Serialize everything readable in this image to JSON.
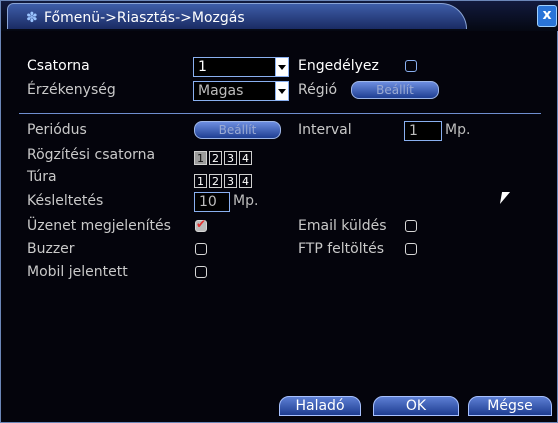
{
  "window": {
    "title": "Főmenü->Riasztás->Mozgás",
    "close_glyph": "x"
  },
  "form": {
    "csatorna": {
      "label": "Csatorna",
      "value": "1"
    },
    "engedelyez": {
      "label": "Engedélyez",
      "checked": false
    },
    "erzekenyseg": {
      "label": "Érzékenység",
      "value": "Magas"
    },
    "regio": {
      "label": "Régió",
      "button": "Beállít"
    },
    "periodus": {
      "label": "Periódus",
      "button": "Beállít"
    },
    "interval": {
      "label": "Interval",
      "value": "1",
      "unit": "Mp."
    },
    "rogzitesi": {
      "label": "Rögzítési csatorna",
      "channels": [
        "1",
        "2",
        "3",
        "4"
      ],
      "selected": [
        "1"
      ]
    },
    "tura": {
      "label": "Túra",
      "channels": [
        "1",
        "2",
        "3",
        "4"
      ],
      "selected": []
    },
    "kesleltetes": {
      "label": "Késleltetés",
      "value": "10",
      "unit": "Mp."
    },
    "uzenet": {
      "label": "Üzenet megjelenítés",
      "checked": true
    },
    "email": {
      "label": "Email küldés",
      "checked": false
    },
    "buzzer": {
      "label": "Buzzer",
      "checked": false
    },
    "ftp": {
      "label": "FTP feltöltés",
      "checked": false
    },
    "mobil": {
      "label": "Mobil jelentett",
      "checked": false
    }
  },
  "buttons": {
    "halado": "Haladó",
    "ok": "OK",
    "megse": "Mégse"
  },
  "colors": {
    "accent": "#3e5da8",
    "background": "#04040c",
    "border": "#8ab0f0"
  }
}
